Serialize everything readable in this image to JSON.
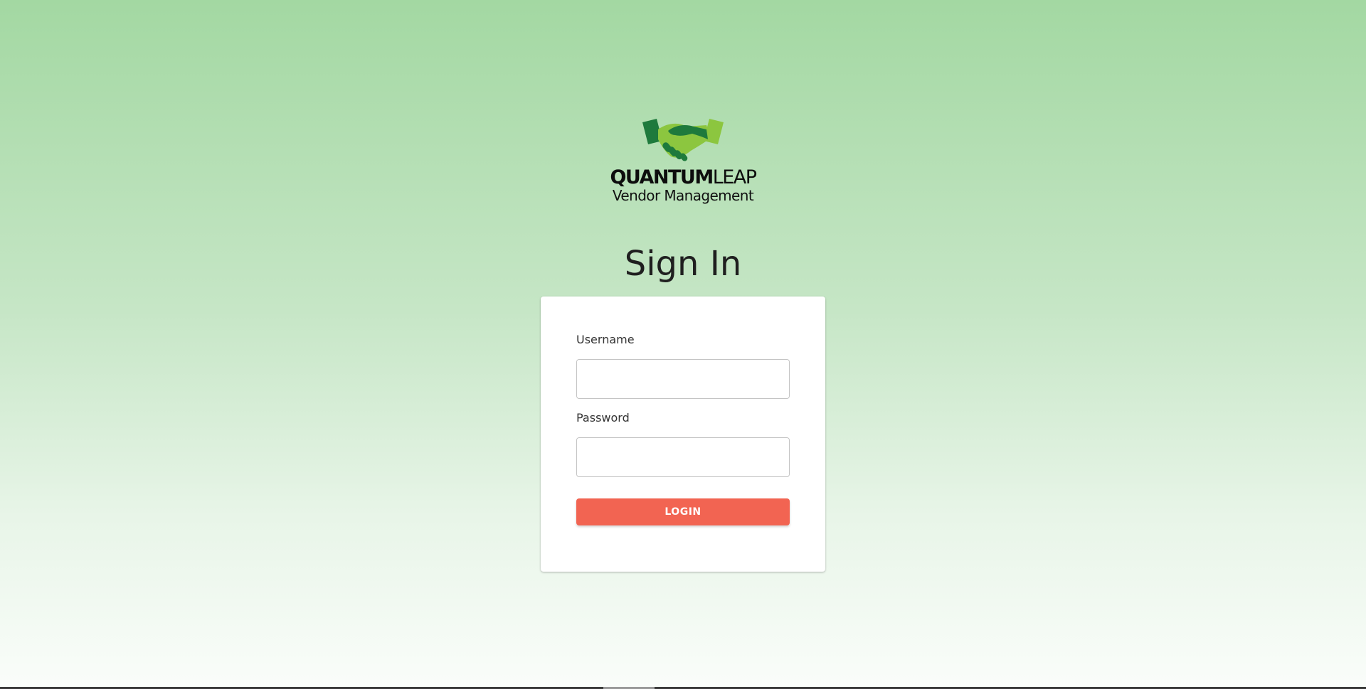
{
  "brand": {
    "name_bold": "QUANTUM",
    "name_light": "LEAP",
    "subtitle": "Vendor Management",
    "logo_icon": "handshake-icon"
  },
  "page": {
    "title": "Sign In"
  },
  "form": {
    "username_label": "Username",
    "username_value": "",
    "password_label": "Password",
    "password_value": "",
    "login_label": "LOGIN"
  },
  "colors": {
    "background_top": "#a3d8a2",
    "background_bottom": "#fafdfa",
    "accent_button": "#f26452",
    "logo_dark_green": "#1e7a3c",
    "logo_light_green": "#8cc63f"
  }
}
